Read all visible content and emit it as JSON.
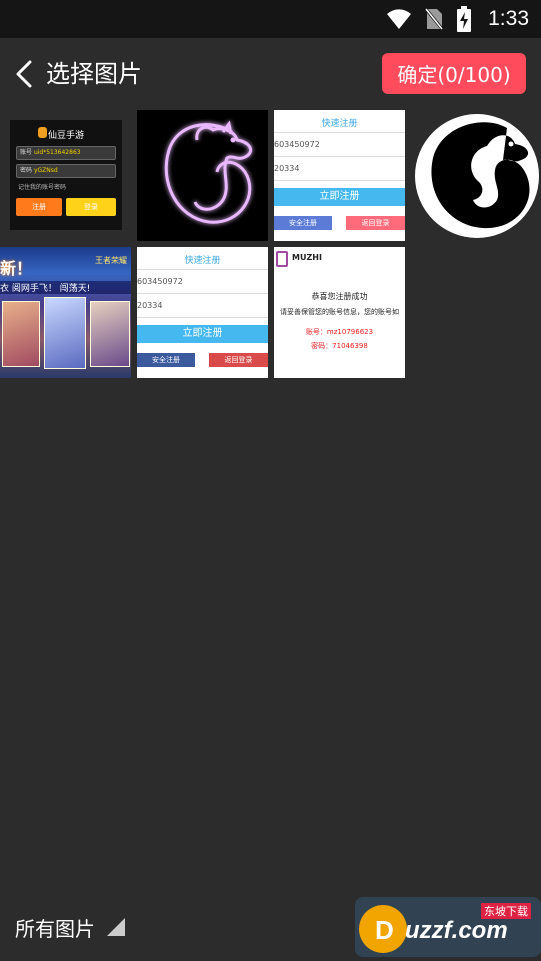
{
  "status_bar": {
    "time": "1:33"
  },
  "header": {
    "title": "选择图片",
    "confirm_label": "确定(0/100)"
  },
  "thumbnails": {
    "t1": {
      "app_name": "仙豆手游",
      "account_label": "账号",
      "account_value": "uid*513642863",
      "password_label": "密码",
      "password_value": "yGZNsd",
      "remember": "记住我的账号密码",
      "btn_register": "注册",
      "btn_login": "登录"
    },
    "t3": {
      "title": "快速注册",
      "field1": "603450972",
      "field2": "20334",
      "submit": "立即注册",
      "left": "安全注册",
      "right": "返回登录"
    },
    "t5": {
      "heading": "新！",
      "subtitle": "王者荣耀",
      "tagline": "衣 阅网手飞！ 闯荡天!"
    },
    "t6": {
      "title": "快速注册",
      "field1": "603450972",
      "field2": "20334",
      "submit": "立即注册",
      "left": "安全注册",
      "right": "返回登录"
    },
    "t7": {
      "brand": "MUZHI",
      "success": "恭喜您注册成功",
      "notice": "请妥善保管您的账号信息，您的账号如",
      "account": "账号：mz10796623",
      "password": "密码：71046398"
    }
  },
  "bottom": {
    "album_label": "所有图片"
  },
  "watermark": {
    "brand": "uzzf.com",
    "tag": "东坡下载"
  },
  "colors": {
    "accent": "#ff4b5c",
    "background": "#2c2c2c",
    "status_bar": "#151515"
  }
}
